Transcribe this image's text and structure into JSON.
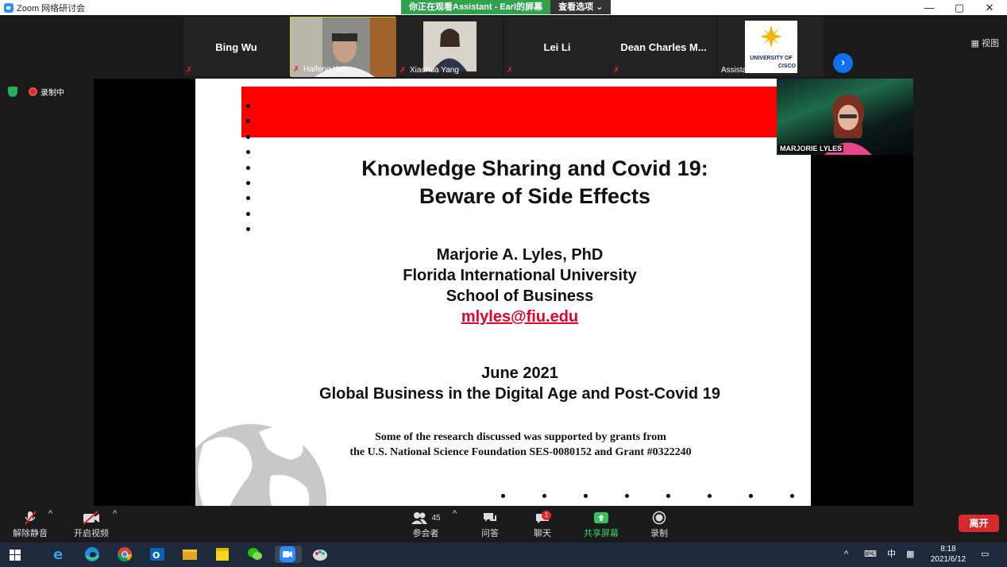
{
  "window": {
    "title": "Zoom 网络研讨会",
    "controls": [
      "—",
      "▢",
      "✕"
    ]
  },
  "share_banner": {
    "message": "你正在观看Assistant - Earl的屏幕",
    "options_label": "查看选项"
  },
  "participants_strip": {
    "tiles": [
      {
        "name": "Bing Wu",
        "label": ""
      },
      {
        "name": "",
        "label": "Haifeng Yan"
      },
      {
        "name": "",
        "label": "Xiaohua Yang"
      },
      {
        "name": "Lei Li",
        "label": ""
      },
      {
        "name": "Dean Charles M...",
        "label": ""
      },
      {
        "name": "",
        "label": "Assistant - Earl"
      }
    ],
    "tile_logo_text": [
      "UNIVERSITY OF",
      "CISCO"
    ],
    "view_label": "视图"
  },
  "recording": {
    "label": "录制中"
  },
  "slide": {
    "title_line1": "Knowledge Sharing and Covid 19:",
    "title_line2": "Beware of Side Effects",
    "author": "Marjorie A. Lyles, PhD",
    "university": "Florida International University",
    "school": "School of Business",
    "email": "mlyles@fiu.edu",
    "date": "June 2021",
    "event": "Global Business in the Digital Age and Post-Covid 19",
    "grant_line1": "Some of the research discussed was supported by grants from",
    "grant_line2": "the U.S. National Science Foundation SES-0080152 and Grant  #0322240",
    "colors": {
      "red_bar": "#ff0000",
      "email": "#e4002b"
    }
  },
  "active_speaker": {
    "label": "MARJORIE LYLES"
  },
  "controls": {
    "unmute": "解除静音",
    "start_video": "开启视频",
    "participants": "参会者",
    "participants_count": "45",
    "qa": "问答",
    "chat": "聊天",
    "chat_badge": "1",
    "share_screen": "共享屏幕",
    "record": "录制",
    "leave": "离开"
  },
  "taskbar": {
    "ime": "中",
    "time": "8:18",
    "date": "2021/6/12"
  }
}
